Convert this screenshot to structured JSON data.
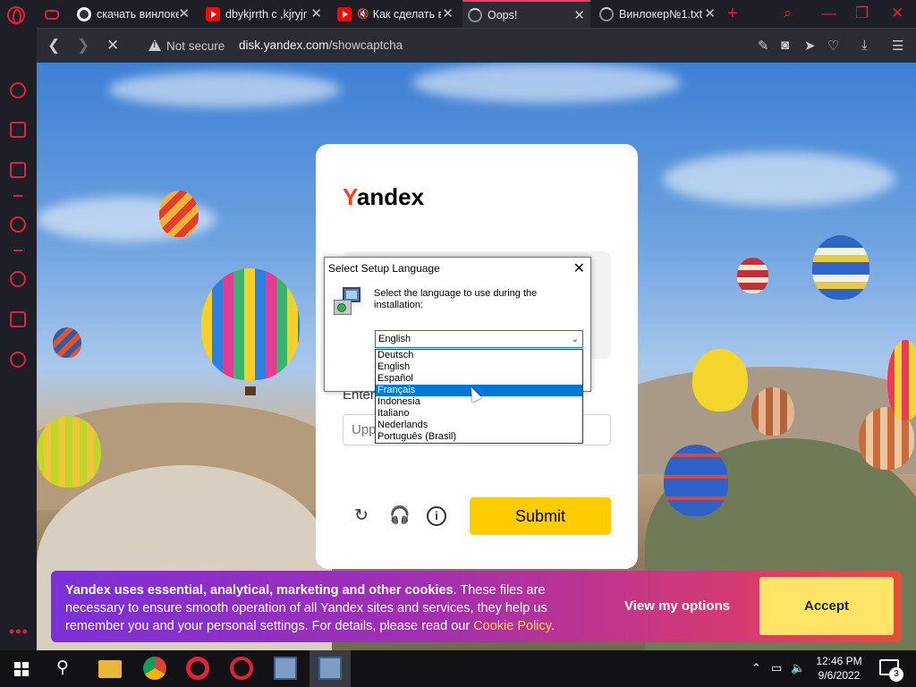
{
  "browser": {
    "tabs": [
      {
        "label": "",
        "icon": "gamepad-icon"
      },
      {
        "label": "скачать винлокер",
        "icon": "globe-icon"
      },
      {
        "label": "dbykjrrth c ,kjryjr",
        "icon": "youtube-icon"
      },
      {
        "label": "Как сделать в",
        "icon": "youtube-icon"
      },
      {
        "label": "Oops!",
        "icon": "loading-icon",
        "active": true
      },
      {
        "label": "Винлокер№1.txt",
        "icon": "loading-icon"
      }
    ],
    "security_label": "Not secure",
    "url_domain": "disk.yandex.com",
    "url_path": "/showcaptcha"
  },
  "captcha_page": {
    "logo_y": "Y",
    "logo_rest": "andex",
    "enter_label": "Enter",
    "input_placeholder": "Upp",
    "submit_label": "Submit"
  },
  "setup_dialog": {
    "title": "Select Setup Language",
    "message": "Select the language to use during the installation:",
    "selected_value": "English",
    "options": [
      "Deutsch",
      "English",
      "Español",
      "Français",
      "Indonesia",
      "Italiano",
      "Nederlands",
      "Português (Brasil)"
    ],
    "highlighted_option": "Français"
  },
  "cookie_banner": {
    "bold_text": "Yandex uses essential, analytical, marketing and other cookies",
    "text": ". These files are necessary to ensure smooth operation of all Yandex sites and services, they help us remember you and your personal settings. For details, please read our ",
    "link": "Cookie Policy",
    "text_end": ".",
    "view_options": "View my options",
    "accept": "Accept"
  },
  "taskbar": {
    "time": "12:46 PM",
    "date": "9/6/2022",
    "notification_count": "3"
  },
  "colors": {
    "opera_red": "#e0213a",
    "yandex_yellow": "#ffcc00",
    "yandex_red": "#fc3f1d",
    "windows_select_blue": "#0078d7"
  }
}
